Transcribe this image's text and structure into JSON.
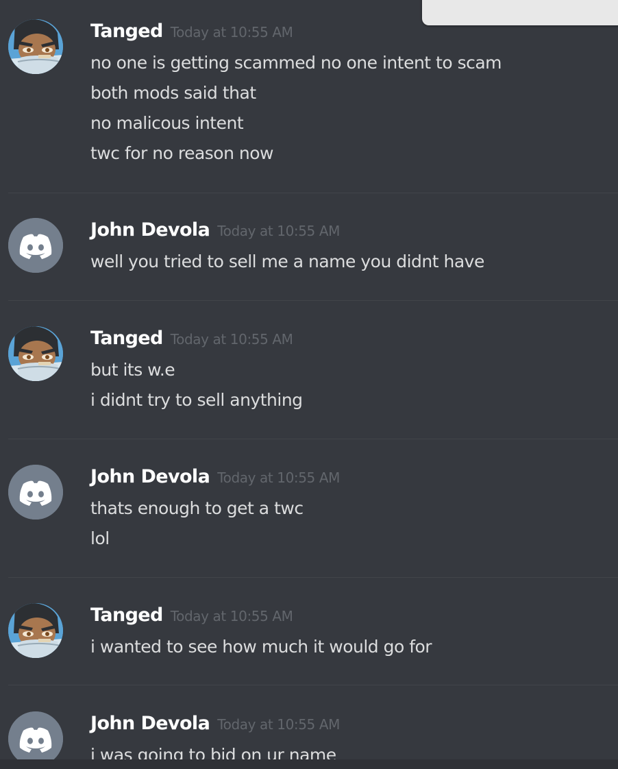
{
  "colors": {
    "background": "#36393f",
    "username": "#ffffff",
    "timestamp": "#62666c",
    "message": "#dcddde",
    "default_avatar": "#747f8d"
  },
  "messages": [
    {
      "author": "Tanged",
      "avatar": "tanged-avatar",
      "timestamp": "Today at 10:55 AM",
      "lines": [
        "no one is getting scammed no one intent to scam",
        "both mods said that",
        "no malicous intent",
        "twc for no reason now"
      ]
    },
    {
      "author": "John Devola",
      "avatar": "discord-default-avatar",
      "timestamp": "Today at 10:55 AM",
      "lines": [
        "well you tried to sell me a name you didnt have"
      ]
    },
    {
      "author": "Tanged",
      "avatar": "tanged-avatar",
      "timestamp": "Today at 10:55 AM",
      "lines": [
        "but its w.e",
        "i didnt try to sell anything"
      ]
    },
    {
      "author": "John Devola",
      "avatar": "discord-default-avatar",
      "timestamp": "Today at 10:55 AM",
      "lines": [
        "thats enough to get a twc",
        "lol"
      ]
    },
    {
      "author": "Tanged",
      "avatar": "tanged-avatar",
      "timestamp": "Today at 10:55 AM",
      "lines": [
        "i wanted to see how much it would go for"
      ]
    },
    {
      "author": "John Devola",
      "avatar": "discord-default-avatar",
      "timestamp": "Today at 10:55 AM",
      "lines": [
        "i was going to bid on ur name"
      ]
    }
  ]
}
